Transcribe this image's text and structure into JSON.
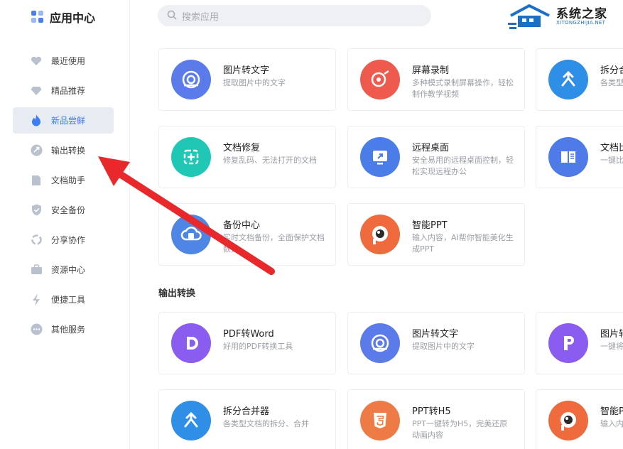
{
  "app": {
    "title": "应用中心"
  },
  "search": {
    "placeholder": "搜索应用"
  },
  "brand": {
    "name": "系统之家",
    "sub": "XITONGZHIJIA.NET"
  },
  "sidebar": {
    "items": [
      {
        "label": "最近使用",
        "icon": "heart-icon"
      },
      {
        "label": "精品推荐",
        "icon": "diamond-icon"
      },
      {
        "label": "新品尝鲜",
        "icon": "flame-icon",
        "active": true
      },
      {
        "label": "输出转换",
        "icon": "convert-icon"
      },
      {
        "label": "文档助手",
        "icon": "document-icon"
      },
      {
        "label": "安全备份",
        "icon": "shield-icon"
      },
      {
        "label": "分享协作",
        "icon": "share-icon"
      },
      {
        "label": "资源中心",
        "icon": "briefcase-icon"
      },
      {
        "label": "便捷工具",
        "icon": "lightning-icon"
      },
      {
        "label": "其他服务",
        "icon": "more-icon"
      }
    ]
  },
  "cards": [
    {
      "title": "图片转文字",
      "desc": "提取图片中的文字",
      "color": "#5b7bea"
    },
    {
      "title": "屏幕录制",
      "desc": "多种模式录制屏幕操作，轻松制作教学视频",
      "color": "#ef5a4f"
    },
    {
      "title": "拆分合",
      "desc": "各类型",
      "color": "#2f8fe6"
    },
    {
      "title": "文档修复",
      "desc": "修复乱码、无法打开的文档",
      "color": "#1fc7b4"
    },
    {
      "title": "远程桌面",
      "desc": "安全易用的远程桌面控制，轻松实现远程办公",
      "color": "#4a7de8"
    },
    {
      "title": "文档比",
      "desc": "一键比出差异",
      "color": "#4f7be8"
    },
    {
      "title": "备份中心",
      "desc": "实时文档备份，全面保护文档数据",
      "color": "#4f86e6"
    },
    {
      "title": "智能PPT",
      "desc": "输入内容，AI帮你智能美化生成PPT",
      "color": "#ef6a3d"
    }
  ],
  "section": {
    "title": "输出转换"
  },
  "cards2": [
    {
      "title": "PDF转Word",
      "desc": "好用的PDF转换工具",
      "color": "#8a5cf0"
    },
    {
      "title": "图片转文字",
      "desc": "提取图片中的文字",
      "color": "#5b7bea"
    },
    {
      "title": "图片转",
      "desc": "一键将",
      "color": "#8a5cf0"
    },
    {
      "title": "拆分合并器",
      "desc": "各类型文档的拆分、合并",
      "color": "#2f8fe6"
    },
    {
      "title": "PPT转H5",
      "desc": "PPT一键转为H5，完美还原动画内容",
      "color": "#ee7a45"
    },
    {
      "title": "智能P",
      "desc": "输入内化生成",
      "color": "#ef6a3d"
    }
  ],
  "colors": {
    "accent": "#3c7cf4",
    "arrow": "#e8282b"
  }
}
